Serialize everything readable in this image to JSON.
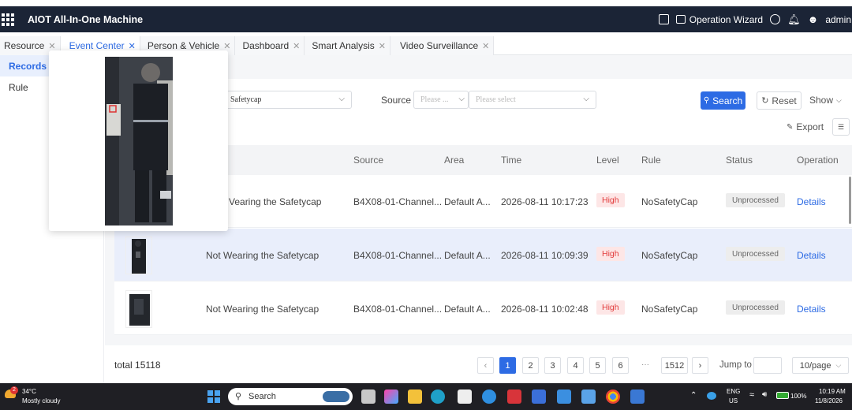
{
  "app": {
    "title": "AIOT All-In-One Machine",
    "wizard_label": "Operation Wizard",
    "user": "admin"
  },
  "tabs": [
    {
      "label": "Resource"
    },
    {
      "label": "Event Center"
    },
    {
      "label": "Person & Vehicle"
    },
    {
      "label": "Dashboard"
    },
    {
      "label": "Smart Analysis"
    },
    {
      "label": "Video Surveillance"
    }
  ],
  "sidebar": {
    "items": [
      {
        "label": "Records"
      },
      {
        "label": "Rule"
      }
    ]
  },
  "filters": {
    "event_type_value": "Safetycap",
    "source_label": "Source",
    "source_type_placeholder": "Please ...",
    "source_placeholder": "Please select",
    "search_label": "Search",
    "reset_label": "Reset",
    "show_label": "Show",
    "export_label": "Export"
  },
  "table": {
    "headers": {
      "source": "Source",
      "area": "Area",
      "time": "Time",
      "level": "Level",
      "rule": "Rule",
      "status": "Status",
      "operation": "Operation"
    },
    "rows": [
      {
        "event": "Not Wearing the Safetycap",
        "event_visible": "Vearing the Safetycap",
        "source": "B4X08-01-Channel...",
        "area": "Default A...",
        "time": "2026-08-11 10:17:23",
        "level": "High",
        "rule": "NoSafetyCap",
        "status": "Unprocessed",
        "op": "Details"
      },
      {
        "event": "Not Wearing the Safetycap",
        "event_visible": "Not Wearing the Safetycap",
        "source": "B4X08-01-Channel...",
        "area": "Default A...",
        "time": "2026-08-11 10:09:39",
        "level": "High",
        "rule": "NoSafetyCap",
        "status": "Unprocessed",
        "op": "Details"
      },
      {
        "event": "Not Wearing the Safetycap",
        "event_visible": "Not Wearing the Safetycap",
        "source": "B4X08-01-Channel...",
        "area": "Default A...",
        "time": "2026-08-11 10:02:48",
        "level": "High",
        "rule": "NoSafetyCap",
        "status": "Unprocessed",
        "op": "Details"
      }
    ]
  },
  "pagination": {
    "total": "total 15118",
    "pages": [
      "1",
      "2",
      "3",
      "4",
      "5",
      "6"
    ],
    "ellipsis": "···",
    "last": "1512",
    "jump_label": "Jump to",
    "per_page": "10/page"
  },
  "taskbar": {
    "weather_temp": "34°C",
    "weather_desc": "Mostly cloudy",
    "weather_badge": "2",
    "search": "Search",
    "lang_top": "ENG",
    "lang_bottom": "US",
    "battery": "100%",
    "time": "10:19 AM",
    "date": "11/8/2026"
  },
  "colors": {
    "accent": "#2d6be4",
    "topbar": "#1b2436",
    "danger": "#e23b3b"
  }
}
